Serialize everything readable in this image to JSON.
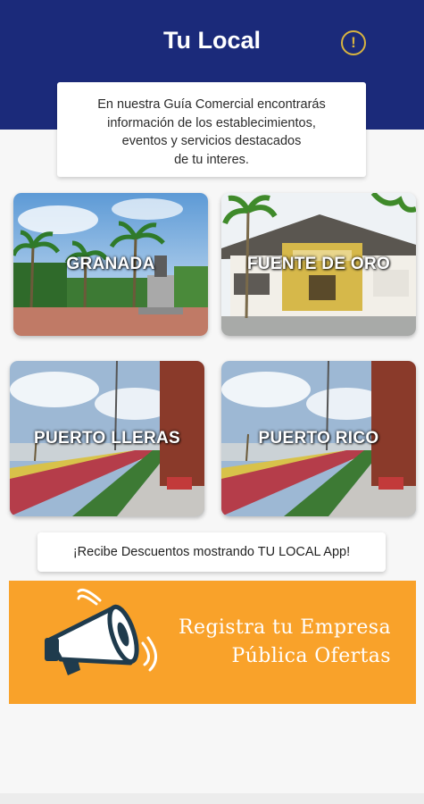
{
  "header": {
    "title": "Tu Local",
    "info_icon": "exclamation-circle-icon",
    "info_glyph": "!",
    "background_color": "#1b2a7a",
    "accent_color": "#d8b440"
  },
  "intro": {
    "lines": [
      "En nuestra Guía Comercial encontrarás",
      "información de los establecimientos,",
      "eventos y servicios destacados",
      "de tu interes."
    ]
  },
  "cities": [
    {
      "label": "GRANADA",
      "image": "plaza-with-monument-photo"
    },
    {
      "label": "FUENTE DE ORO",
      "image": "building-facade-photo"
    },
    {
      "label": "PUERTO LLERAS",
      "image": "promenade-street-photo"
    },
    {
      "label": "PUERTO RICO",
      "image": "promenade-street-photo"
    }
  ],
  "promo": {
    "text": "¡Recibe Descuentos mostrando TU LOCAL App!"
  },
  "register": {
    "line1": "Registra tu Empresa",
    "line2": "Pública Ofertas",
    "icon": "megaphone-icon",
    "background_color": "#f9a22a"
  }
}
